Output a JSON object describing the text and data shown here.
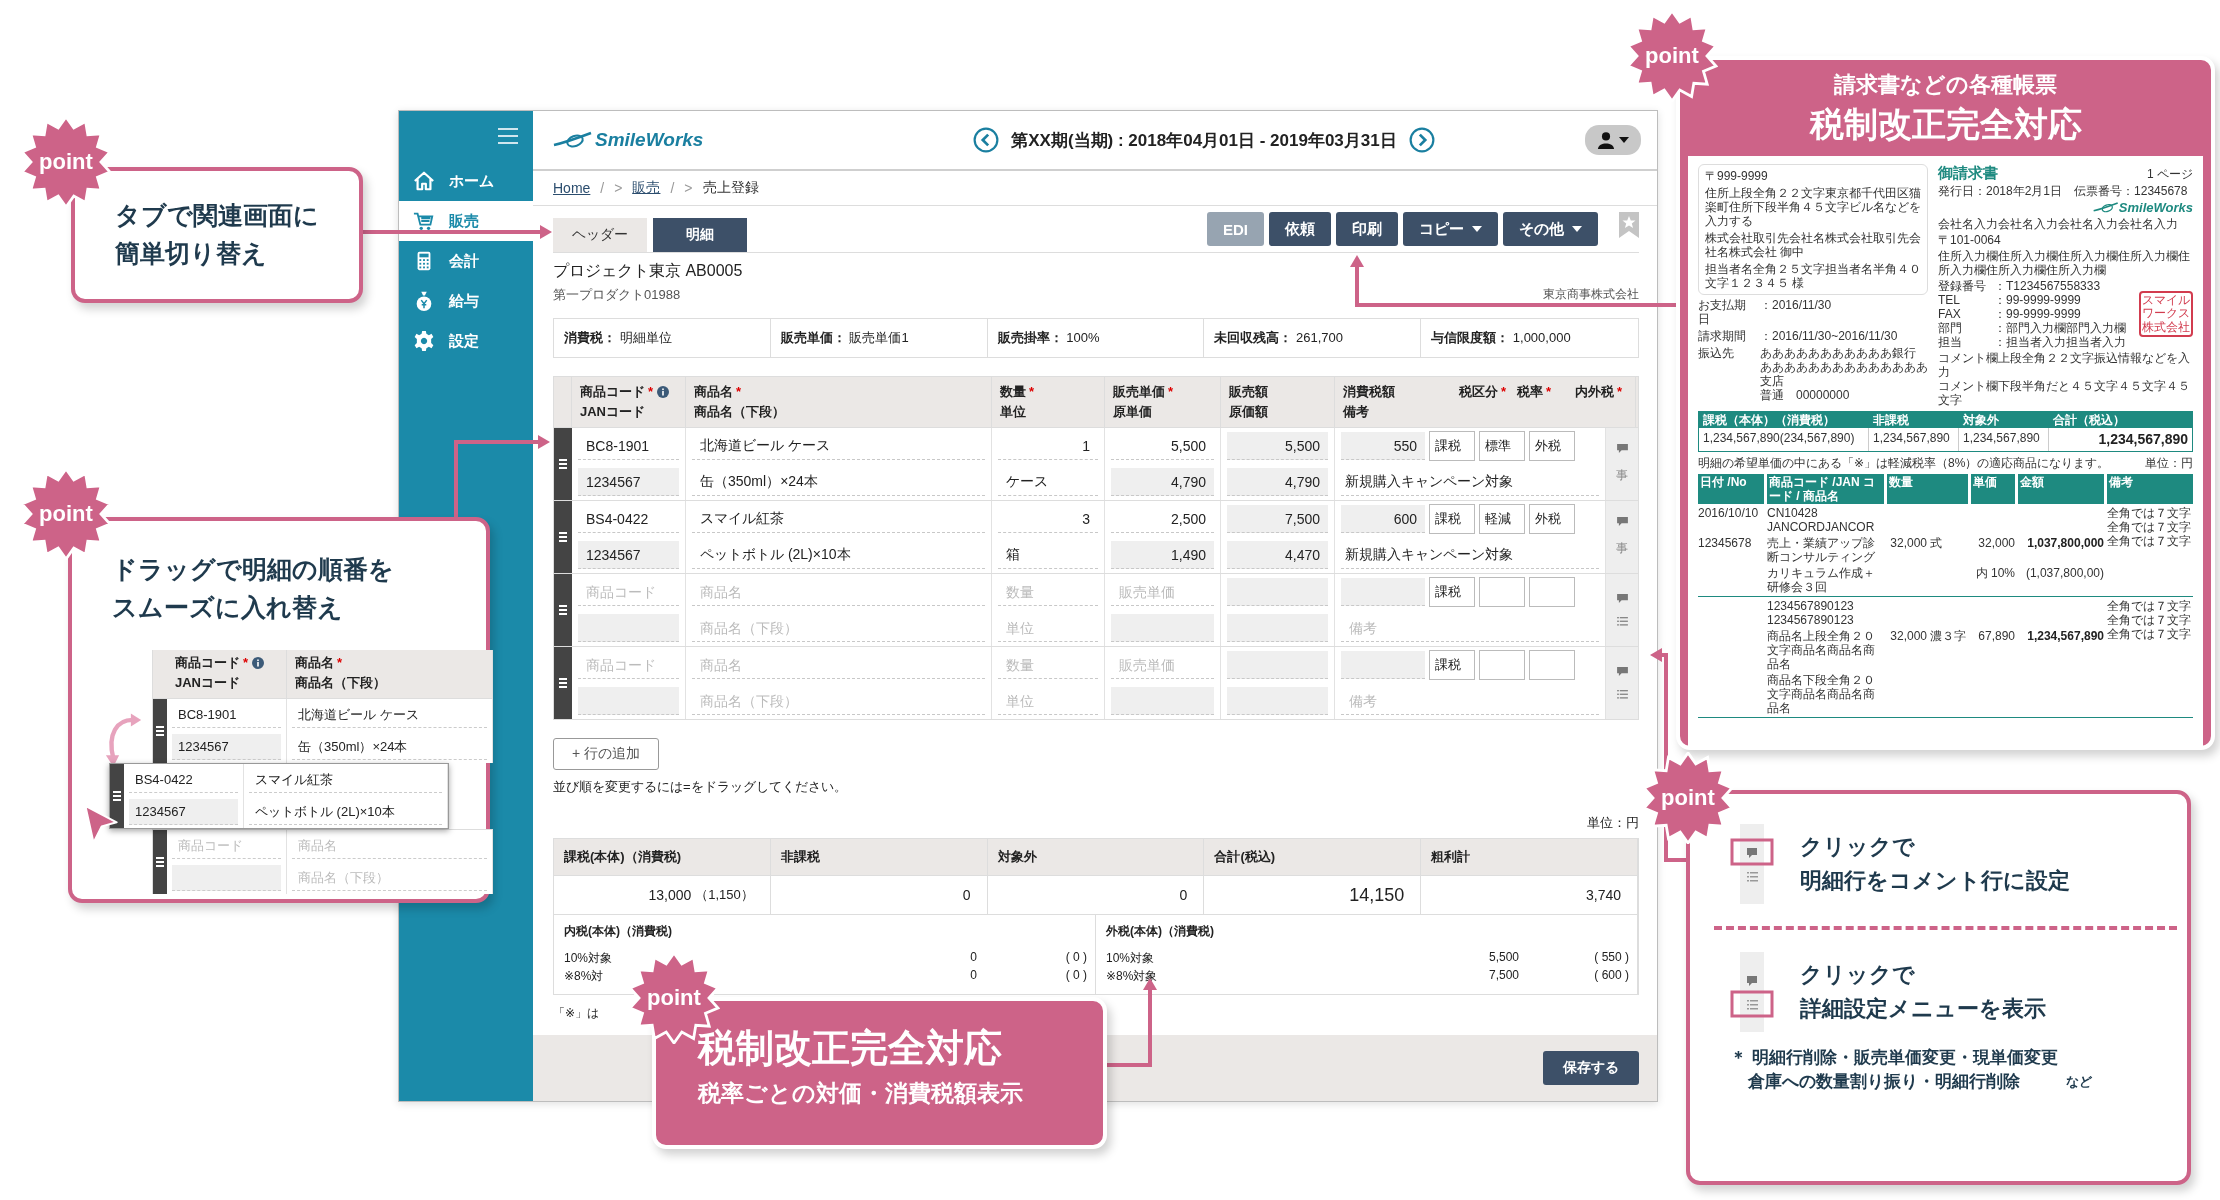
{
  "app": {
    "logo": "SmileWorks",
    "period": "第XX期(当期) : 2018年04月01日 - 2019年03月31日",
    "sidebar": [
      {
        "label": "ホーム",
        "selected": false
      },
      {
        "label": "販売",
        "selected": true
      },
      {
        "label": "会計",
        "selected": false
      },
      {
        "label": "給与",
        "selected": false
      },
      {
        "label": "設定",
        "selected": false
      }
    ],
    "breadcrumb": [
      {
        "text": "Home",
        "kind": "link"
      },
      {
        "text": "/",
        "kind": "separator"
      },
      {
        "text": ">",
        "kind": "separator"
      },
      {
        "text": "販売",
        "kind": "link"
      },
      {
        "text": "/",
        "kind": "separator"
      },
      {
        "text": ">",
        "kind": "separator"
      },
      {
        "text": "売上登録",
        "kind": "current"
      }
    ],
    "tabs": [
      {
        "label": "ヘッダー",
        "selected": false
      },
      {
        "label": "明細",
        "selected": true
      }
    ],
    "actions": [
      {
        "label": "EDI",
        "disabled": true,
        "dropdown": false
      },
      {
        "label": "依頼",
        "disabled": false,
        "dropdown": false
      },
      {
        "label": "印刷",
        "disabled": false,
        "dropdown": false
      },
      {
        "label": "コピー",
        "disabled": false,
        "dropdown": true
      },
      {
        "label": "その他",
        "disabled": false,
        "dropdown": true
      }
    ],
    "project": {
      "title": "プロジェクト東京 AB0005",
      "subtitle": "第一プロダクト01988",
      "customer": "東京商事株式会社"
    },
    "info": [
      {
        "label": "消費税：",
        "value": "明細単位"
      },
      {
        "label": "販売単価：",
        "value": "販売単価1"
      },
      {
        "label": "販売掛率：",
        "value": "100%"
      },
      {
        "label": "未回収残高：",
        "value": "261,700"
      },
      {
        "label": "与信限度額：",
        "value": "1,000,000"
      }
    ],
    "columns": [
      {
        "top": "商品コード",
        "bottom": "JANコード",
        "mark": "*",
        "info": true
      },
      {
        "top": "商品名",
        "bottom": "商品名（下段）",
        "mark": "*",
        "info": false
      },
      {
        "top": "数量",
        "bottom": "単位",
        "mark": "*",
        "info": false
      },
      {
        "top": "販売単価",
        "bottom": "原単価",
        "mark": "*",
        "info": false
      },
      {
        "top": "販売額",
        "bottom": "原価額",
        "info": false
      },
      {
        "top": "消費税額",
        "bottom": "備考",
        "info": false
      }
    ],
    "tax_headers": [
      {
        "label": "税区分",
        "mark": "*"
      },
      {
        "label": "税率",
        "mark": "*"
      },
      {
        "label": "内外税",
        "mark": "*"
      }
    ],
    "rows": [
      {
        "kind": "item",
        "code": "BC8-1901",
        "jan": "1234567",
        "name": "北海道ビール ケース",
        "name2": "缶（350ml）×24本",
        "qty": "1",
        "unit": "ケース",
        "price": "5,500",
        "cost": "4,790",
        "amount": "5,500",
        "cost_amount": "4,790",
        "tax": "550",
        "tax_class": "課税",
        "tax_rate": "標準",
        "tax_mode": "外税",
        "note": "新規購入キャンペーン対象",
        "side_mark": "事"
      },
      {
        "kind": "item",
        "code": "BS4-0422",
        "jan": "1234567",
        "name": "スマイル紅茶",
        "name2": "ペットボトル (2L)×10本",
        "qty": "3",
        "unit": "箱",
        "price": "2,500",
        "cost": "1,490",
        "amount": "7,500",
        "cost_amount": "4,470",
        "tax": "600",
        "tax_class": "課税",
        "tax_rate": "軽減",
        "tax_mode": "外税",
        "note": "新規購入キャンペーン対象",
        "side_mark": "事"
      },
      {
        "kind": "blank",
        "code": {
          "placeholder": "商品コード"
        },
        "name": {
          "placeholder": "商品名"
        },
        "name2": {
          "placeholder": "商品名（下段）"
        },
        "qty": {
          "placeholder": "数量"
        },
        "unit": {
          "placeholder": "単位"
        },
        "price": {
          "placeholder": "販売単価"
        },
        "note": {
          "placeholder": "備考"
        },
        "tax_class": "課税"
      },
      {
        "kind": "blank",
        "code": {
          "placeholder": "商品コード"
        },
        "name": {
          "placeholder": "商品名"
        },
        "name2": {
          "placeholder": "商品名（下段）"
        },
        "qty": {
          "placeholder": "数量"
        },
        "unit": {
          "placeholder": "単位"
        },
        "price": {
          "placeholder": "販売単価"
        },
        "note": {
          "placeholder": "備考"
        },
        "tax_class": "課税"
      }
    ],
    "add_row": "+ 行の追加",
    "hint": "並び順を変更するには=をドラッグしてください。",
    "unit": "単位：円",
    "totals": [
      {
        "label": "課税(本体)（消費税)",
        "value": "13,000",
        "sub": "（1,150）",
        "emphasis": false
      },
      {
        "label": "非課税",
        "value": "0",
        "emphasis": false
      },
      {
        "label": "対象外",
        "value": "0",
        "emphasis": false
      },
      {
        "label": "合計(税込)",
        "value": "14,150",
        "emphasis": true
      },
      {
        "label": "粗利計",
        "value": "3,740",
        "emphasis": false
      }
    ],
    "breakdown": [
      {
        "title": "内税(本体)（消費税)",
        "rows": [
          {
            "label": "10%対象",
            "amount": "0",
            "tax": "( 0 )"
          },
          {
            "label": "※8%対",
            "amount": "0",
            "tax": "( 0 )"
          }
        ]
      },
      {
        "title": "外税(本体)（消費税)",
        "rows": [
          {
            "label": "10%対象",
            "amount": "5,500",
            "tax": "( 550 )"
          },
          {
            "label": "※8%対象",
            "amount": "7,500",
            "tax": "( 600 )"
          }
        ]
      }
    ],
    "footnote": "「※」は",
    "save": "保存する"
  },
  "callout_tabs": {
    "badge": "point",
    "lines": [
      "タブで関連画面に",
      "簡単切り替え"
    ]
  },
  "callout_drag": {
    "badge": "point",
    "lines": [
      "ドラッグで明細の順番を",
      "スムーズに入れ替え"
    ],
    "demo": {
      "columns": [
        {
          "top": "商品コード",
          "bottom": "JANコード",
          "mark": "*",
          "info": true
        },
        {
          "top": "商品名",
          "bottom": "商品名（下段）",
          "mark": "*",
          "info": false
        }
      ],
      "rows": [
        {
          "kind": "item",
          "dragging": false,
          "code": "BC8-1901",
          "jan": "1234567",
          "name": "北海道ビール ケース",
          "name2": "缶（350ml）×24本"
        },
        {
          "kind": "item",
          "dragging": true,
          "code": "BS4-0422",
          "jan": "1234567",
          "name": "スマイル紅茶",
          "name2": "ペットボトル (2L)×10本"
        },
        {
          "kind": "blank",
          "dragging": false,
          "code": {
            "placeholder": "商品コード"
          },
          "name": {
            "placeholder": "商品名"
          },
          "name2": {
            "placeholder": "商品名（下段）"
          }
        }
      ]
    }
  },
  "callout_invoice": {
    "badge": "point",
    "title": "請求書などの各種帳票",
    "headline": "税制改正完全対応",
    "document": {
      "address": [
        "〒999-9999",
        "住所上段全角２２文字東京都千代田区猫楽町住所下段半角４５文字ビル名などを入力する",
        "株式会社取引先会社名株式会社取引先会社名株式会社 御中",
        "担当者名全角２５文字担当者名半角４０文字１２３４５ 様"
      ],
      "payment": [
        {
          "label": "お支払期日",
          "value": "：2016/11/30"
        },
        {
          "label": "請求期間",
          "value": "：2016/11/30~2016/11/30"
        }
      ],
      "bank_label": "振込先",
      "bank": [
        "あああああああああああ銀行",
        "ああああああああああああああ支店",
        "普通　00000000"
      ],
      "title": "御請求書",
      "page": "1 ページ",
      "issued": "発行日：2018年2月1日　伝票番号：12345678",
      "logo": "SmileWorks",
      "company": "会社名入力会社名入力会社名入力会社名入力",
      "zip": "〒101-0064",
      "company_address": "住所入力欄住所入力欄住所入力欄住所入力欄住所入力欄住所入力欄住所入力欄",
      "contacts": [
        {
          "label": "登録番号",
          "value": "：T1234567558333"
        },
        {
          "label": "TEL",
          "value": "：99-9999-9999"
        },
        {
          "label": "FAX",
          "value": "：99-9999-9999"
        },
        {
          "label": "部門",
          "value": "：部門入力欄部門入力欄"
        },
        {
          "label": "担当",
          "value": "：担当者入力担当者入力"
        }
      ],
      "stamp": "スマイルワークス株式会社",
      "comments": [
        "コメント欄上段全角２２文字振込情報などを入力",
        "コメント欄下段半角だと４５文字４５文字４５文字"
      ],
      "summary_columns": [
        "課税（本体）（消費税）",
        "非課税",
        "対象外",
        "合計（税込）"
      ],
      "summary_values": [
        "1,234,567,890(234,567,890)",
        "1,234,567,890",
        "1,234,567,890",
        "1,234,567,890"
      ],
      "note": "明細の希望単価の中にある「※」は軽減税率（8%）の適応商品になります。",
      "unit": "単位：円",
      "detail_columns": [
        "日付 /No",
        "商品コード /JAN コード / 商品名",
        "数量",
        "単価",
        "金額",
        "備考"
      ],
      "details": [
        {
          "date": "2016/10/10",
          "no": "12345678",
          "code": "CN10428",
          "jan": "JANCORDJANCOR",
          "name": "売上・業績アップ診断コンサルティング",
          "name2": "カリキュラム作成＋研修会３回",
          "qty": "32,000",
          "unit": "式",
          "price": "32,000",
          "amount": "1,037,800,000",
          "tax_note": "内 10%",
          "tax_amount": "(1,037,800,00)",
          "notes": [
            "全角では７文字",
            "全角では７文字",
            "全角では７文字"
          ]
        },
        {
          "code": "1234567890123",
          "jan": "1234567890123",
          "name": "商品名上段全角２０文字商品名商品名商品名",
          "name2": "商品名下段全角２０文字商品名商品名商品名",
          "qty": "32,000",
          "unit": "濃３字",
          "price": "67,890",
          "amount": "1,234,567,890",
          "notes": [
            "全角では７文字",
            "全角では７文字",
            "全角では７文字"
          ]
        }
      ]
    }
  },
  "callout_row_menu": {
    "badge": "point",
    "items": [
      {
        "kind": "comment",
        "lines": [
          "クリックで",
          "明細行をコメント行に設定"
        ]
      },
      {
        "kind": "menu",
        "lines": [
          "クリックで",
          "詳細設定メニューを表示"
        ]
      }
    ],
    "note": [
      "＊ 明細行削除・販売単価変更・現単価変更",
      "倉庫への数量割り振り・明細行削除"
    ],
    "note_suffix": "など"
  },
  "callout_tax": {
    "badge": "point",
    "headline": "税制改正完全対応",
    "sub": "税率ごとの対価・消費税額表示"
  }
}
